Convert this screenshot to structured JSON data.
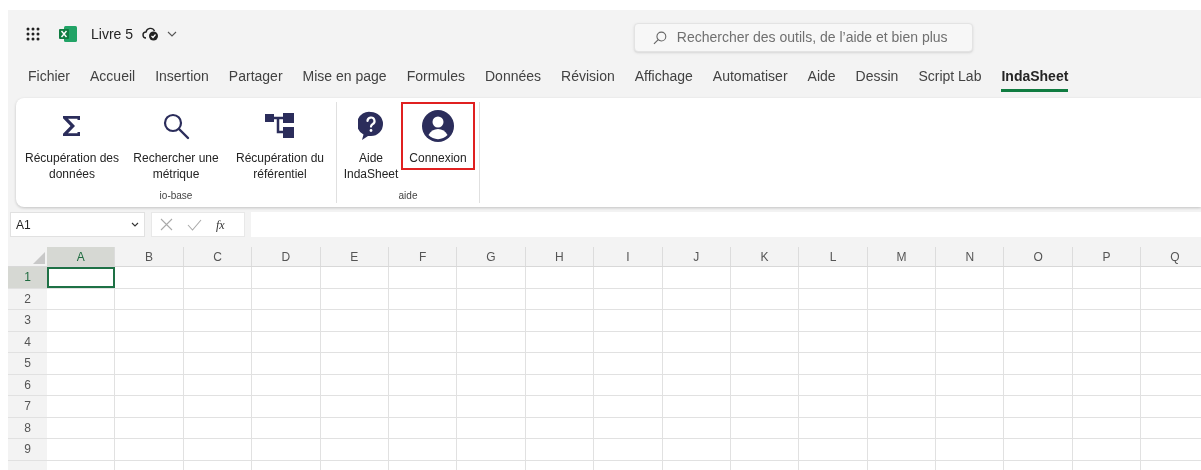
{
  "title_bar": {
    "document_name": "Livre 5"
  },
  "search": {
    "placeholder": "Rechercher des outils, de l’aide et bien plus"
  },
  "tabs": [
    {
      "label": "Fichier",
      "selected": false
    },
    {
      "label": "Accueil",
      "selected": false
    },
    {
      "label": "Insertion",
      "selected": false
    },
    {
      "label": "Partager",
      "selected": false
    },
    {
      "label": "Mise en page",
      "selected": false
    },
    {
      "label": "Formules",
      "selected": false
    },
    {
      "label": "Données",
      "selected": false
    },
    {
      "label": "Révision",
      "selected": false
    },
    {
      "label": "Affichage",
      "selected": false
    },
    {
      "label": "Automatiser",
      "selected": false
    },
    {
      "label": "Aide",
      "selected": false
    },
    {
      "label": "Dessin",
      "selected": false
    },
    {
      "label": "Script Lab",
      "selected": false
    },
    {
      "label": "IndaSheet",
      "selected": true
    }
  ],
  "ribbon": {
    "groups": [
      {
        "label": "io-base",
        "buttons": [
          {
            "label": "Récupération des données",
            "kind": "sigma",
            "highlighted": false
          },
          {
            "label": "Rechercher une métrique",
            "kind": "search",
            "highlighted": false
          },
          {
            "label": "Récupération du référentiel",
            "kind": "hierarchy",
            "highlighted": false
          }
        ]
      },
      {
        "label": "aide",
        "buttons": [
          {
            "label": "Aide IndaSheet",
            "kind": "help",
            "highlighted": false
          },
          {
            "label": "Connexion",
            "kind": "user",
            "highlighted": true
          }
        ]
      }
    ]
  },
  "formula_bar": {
    "name_box": "A1",
    "function_label": "fx"
  },
  "grid": {
    "columns": [
      {
        "label": "A",
        "selected": true
      },
      {
        "label": "B",
        "selected": false
      },
      {
        "label": "C",
        "selected": false
      },
      {
        "label": "D",
        "selected": false
      },
      {
        "label": "E",
        "selected": false
      },
      {
        "label": "F",
        "selected": false
      },
      {
        "label": "G",
        "selected": false
      },
      {
        "label": "H",
        "selected": false
      },
      {
        "label": "I",
        "selected": false
      },
      {
        "label": "J",
        "selected": false
      },
      {
        "label": "K",
        "selected": false
      },
      {
        "label": "L",
        "selected": false
      },
      {
        "label": "M",
        "selected": false
      },
      {
        "label": "N",
        "selected": false
      },
      {
        "label": "O",
        "selected": false
      },
      {
        "label": "P",
        "selected": false
      },
      {
        "label": "Q",
        "selected": false
      }
    ],
    "rows": [
      {
        "label": "1",
        "selected": true
      },
      {
        "label": "2",
        "selected": false
      },
      {
        "label": "3",
        "selected": false
      },
      {
        "label": "4",
        "selected": false
      },
      {
        "label": "5",
        "selected": false
      },
      {
        "label": "6",
        "selected": false
      },
      {
        "label": "7",
        "selected": false
      },
      {
        "label": "8",
        "selected": false
      },
      {
        "label": "9",
        "selected": false
      }
    ]
  }
}
